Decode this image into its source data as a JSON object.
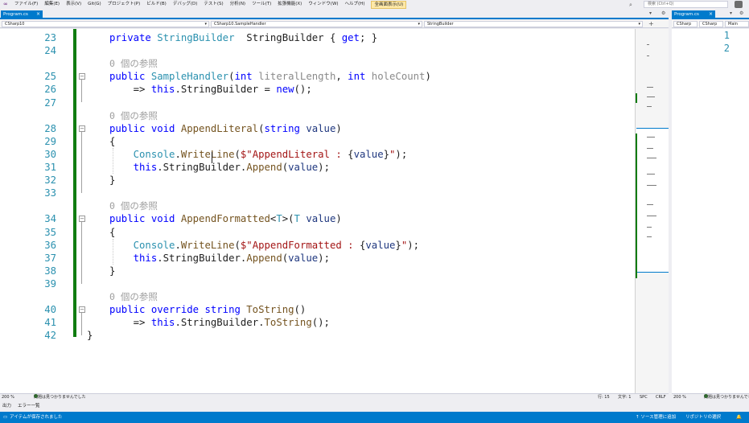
{
  "menu": {
    "items": [
      "ファイル(F)",
      "編集(E)",
      "表示(V)",
      "Git(G)",
      "プロジェクト(P)",
      "ビルド(B)",
      "デバッグ(D)",
      "テスト(S)",
      "分析(N)",
      "ツール(T)",
      "拡張機能(X)",
      "ウィンドウ(W)",
      "ヘルプ(H)"
    ],
    "run_button": "全画面表示(U)",
    "search_placeholder": "検索 (Ctrl+Q)"
  },
  "left_pane": {
    "tab": "Program.cs",
    "tab_close": "×",
    "nav": {
      "project": "CSharp10",
      "class": "CSharp10.SampleHandler",
      "member": "StringBuilder"
    },
    "code_lines": [
      {
        "ln": "23",
        "segments": [
          [
            "kw",
            "private "
          ],
          [
            "ty",
            "StringBuilder"
          ],
          [
            "",
            "  StringBuilder { "
          ],
          [
            "kw",
            "get"
          ],
          [
            "",
            "; }"
          ]
        ],
        "indent": 0
      },
      {
        "ln": "24",
        "segments": [],
        "indent": 0
      },
      {
        "ref": "0 個の参照"
      },
      {
        "ln": "25",
        "segments": [
          [
            "kw",
            "public "
          ],
          [
            "ty",
            "SampleHandler"
          ],
          [
            "",
            "("
          ],
          [
            "kw",
            "int "
          ],
          [
            "gr",
            "literalLength"
          ],
          [
            "",
            ", "
          ],
          [
            "kw",
            "int "
          ],
          [
            "gr",
            "holeCount"
          ],
          [
            "",
            ")"
          ]
        ],
        "indent": 0
      },
      {
        "ln": "26",
        "segments": [
          [
            "",
            "    => "
          ],
          [
            "kw",
            "this"
          ],
          [
            "",
            ".StringBuilder = "
          ],
          [
            "kw",
            "new"
          ],
          [
            "",
            "();"
          ]
        ],
        "indent": 0
      },
      {
        "ln": "27",
        "segments": [],
        "indent": 0
      },
      {
        "ref": "0 個の参照"
      },
      {
        "ln": "28",
        "segments": [
          [
            "kw",
            "public void "
          ],
          [
            "me",
            "AppendLiteral"
          ],
          [
            "",
            "("
          ],
          [
            "kw",
            "string "
          ],
          [
            "pa",
            "value"
          ],
          [
            "",
            ")"
          ]
        ],
        "indent": 0
      },
      {
        "ln": "29",
        "segments": [
          [
            "",
            "{"
          ]
        ],
        "indent": 0
      },
      {
        "ln": "30",
        "segments": [
          [
            "",
            "    "
          ],
          [
            "ty",
            "Console"
          ],
          [
            "",
            "."
          ],
          [
            "me",
            "WriteLine"
          ],
          [
            "",
            "("
          ],
          [
            "st",
            "$\"AppendLiteral : "
          ],
          [
            "",
            "{"
          ],
          [
            "pa",
            "value"
          ],
          [
            "",
            "}"
          ],
          [
            "st",
            "\""
          ],
          [
            "",
            ");"
          ]
        ],
        "indent": 0
      },
      {
        "ln": "31",
        "segments": [
          [
            "",
            "    "
          ],
          [
            "kw",
            "this"
          ],
          [
            "",
            ".StringBuilder."
          ],
          [
            "me",
            "Append"
          ],
          [
            "",
            "("
          ],
          [
            "pa",
            "value"
          ],
          [
            "",
            ");"
          ]
        ],
        "indent": 0
      },
      {
        "ln": "32",
        "segments": [
          [
            "",
            "}"
          ]
        ],
        "indent": 0
      },
      {
        "ln": "33",
        "segments": [],
        "indent": 0
      },
      {
        "ref": "0 個の参照"
      },
      {
        "ln": "34",
        "segments": [
          [
            "kw",
            "public void "
          ],
          [
            "me",
            "AppendFormatted"
          ],
          [
            "",
            "<"
          ],
          [
            "tp",
            "T"
          ],
          [
            "",
            ">("
          ],
          [
            "tp",
            "T "
          ],
          [
            "pa",
            "value"
          ],
          [
            "",
            ")"
          ]
        ],
        "indent": 0
      },
      {
        "ln": "35",
        "segments": [
          [
            "",
            "{"
          ]
        ],
        "indent": 0
      },
      {
        "ln": "36",
        "segments": [
          [
            "",
            "    "
          ],
          [
            "ty",
            "Console"
          ],
          [
            "",
            "."
          ],
          [
            "me",
            "WriteLine"
          ],
          [
            "",
            "("
          ],
          [
            "st",
            "$\"AppendFormatted : "
          ],
          [
            "",
            "{"
          ],
          [
            "pa",
            "value"
          ],
          [
            "",
            "}"
          ],
          [
            "st",
            "\""
          ],
          [
            "",
            ");"
          ]
        ],
        "indent": 0
      },
      {
        "ln": "37",
        "segments": [
          [
            "",
            "    "
          ],
          [
            "kw",
            "this"
          ],
          [
            "",
            ".StringBuilder."
          ],
          [
            "me",
            "Append"
          ],
          [
            "",
            "("
          ],
          [
            "pa",
            "value"
          ],
          [
            "",
            ");"
          ]
        ],
        "indent": 0
      },
      {
        "ln": "38",
        "segments": [
          [
            "",
            "}"
          ]
        ],
        "indent": 0
      },
      {
        "ln": "39",
        "segments": [],
        "indent": 0
      },
      {
        "ref": "0 個の参照"
      },
      {
        "ln": "40",
        "segments": [
          [
            "kw",
            "public override string "
          ],
          [
            "me",
            "ToString"
          ],
          [
            "",
            "()"
          ]
        ],
        "indent": 0
      },
      {
        "ln": "41",
        "segments": [
          [
            "",
            "    => "
          ],
          [
            "kw",
            "this"
          ],
          [
            "",
            ".StringBuilder."
          ],
          [
            "me",
            "ToString"
          ],
          [
            "",
            "();"
          ]
        ],
        "indent": 0
      },
      {
        "ln": "42",
        "segments": [
          [
            "",
            "}"
          ]
        ],
        "indent": -1
      }
    ],
    "status": {
      "zoom": "200 %",
      "issues": "問題は見つかりませんでした",
      "line": "行: 15",
      "col": "文字: 1",
      "spc": "SPC",
      "crlf": "CRLF"
    }
  },
  "right_pane": {
    "tab": "Program.cs",
    "tab_close": "×",
    "nav": {
      "project": "CSharp",
      "class": "CSharp",
      "member": "Main"
    },
    "line_numbers": [
      "1",
      "2"
    ],
    "status": {
      "zoom": "200 %",
      "issues": "問題は見つかりませんでした"
    }
  },
  "output_tabs": [
    "出力",
    "エラー一覧"
  ],
  "app_status": {
    "left": "アイテムが保存されました",
    "source_control": "↑ ソース管理に追加",
    "repo": "リポジトリの選択"
  },
  "colors": {
    "accent": "#007acc",
    "keyword": "#0000ff",
    "type": "#2b91af",
    "method": "#74531f",
    "string": "#a31515",
    "param": "#1f377f",
    "change_bar": "#107c10"
  }
}
